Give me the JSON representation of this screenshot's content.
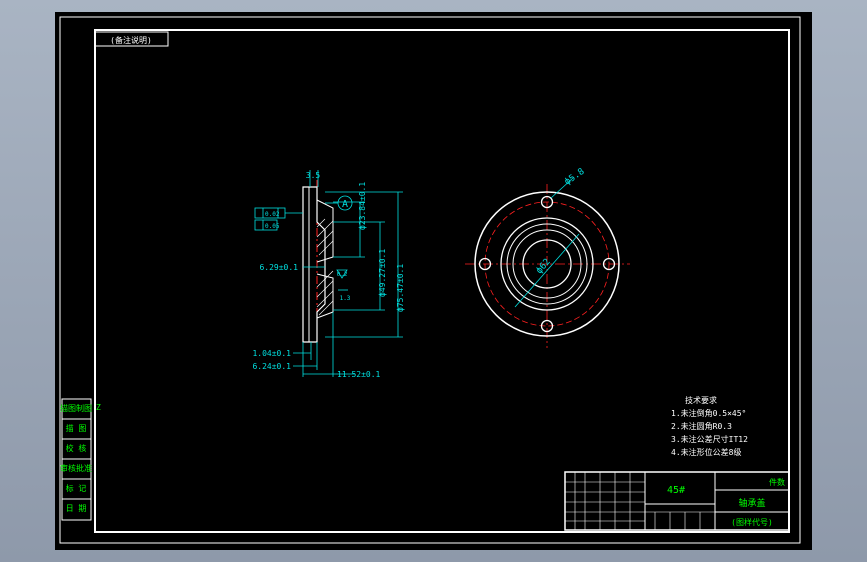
{
  "drawing": {
    "stamp_label": "(备注说明)",
    "side_labels": [
      "描图制图",
      "描 图",
      "校 核",
      "审核批准",
      "标 记",
      "日 期"
    ],
    "side_note": "Z",
    "dims": {
      "top_small": "3.5",
      "tol_1": "0.02",
      "tol_2": "0.05",
      "datum": "A",
      "d_inner": "ф23.84±0.1",
      "d_mid": "ф49.27±0.1",
      "d_outer": "ф75.47±0.1",
      "step": "6.29±0.1",
      "small_a": "0.2",
      "small_b": "1.3",
      "t1": "1.04±0.1",
      "t2": "6.24±0.1",
      "width": "11.52±0.1",
      "hole": "ф5.8",
      "pcd": "ф62"
    },
    "tech_req": {
      "title": "技术要求",
      "items": [
        "1.未注倒角0.5×45°",
        "2.未注圆角R0.3",
        "3.未注公差尺寸IT12",
        "4.未注形位公差8级"
      ]
    },
    "title_block": {
      "material": "45#",
      "part_name": "轴承盖",
      "top_right": "件数",
      "bottom_right": "(图样代号)"
    }
  },
  "colors": {
    "background": "#000000",
    "frame": "#ffffff",
    "dimension": "#00e0e0",
    "center_line": "#ff2020",
    "accent_green": "#00ff00"
  }
}
